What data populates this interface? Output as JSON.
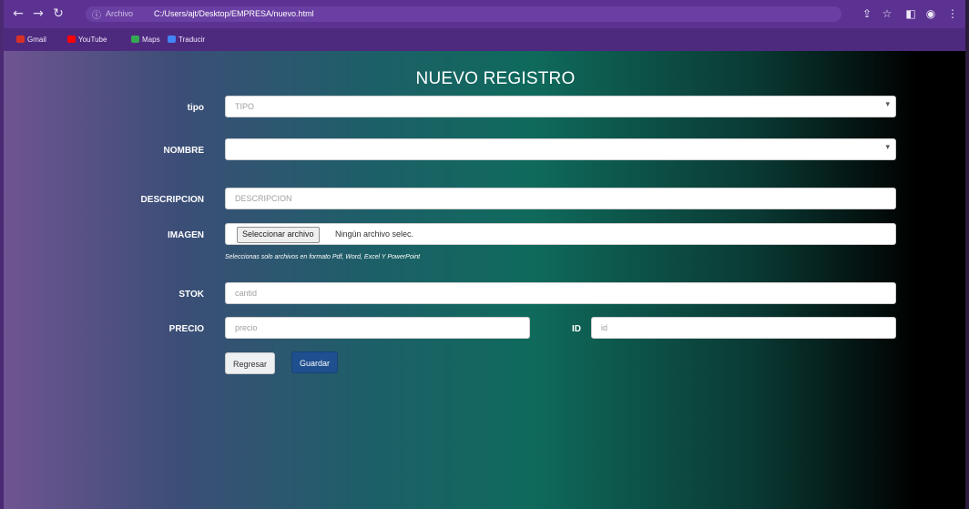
{
  "browser": {
    "address_label": "Archivo",
    "url": "C:/Users/ajt/Desktop/EMPRESA/nuevo.html",
    "bookmarks": [
      {
        "label": "Gmail",
        "color": "#d93025"
      },
      {
        "label": "YouTube",
        "color": "#ff0000"
      },
      {
        "label": "Maps",
        "color": "#34a853"
      },
      {
        "label": "Traducir",
        "color": "#4285f4"
      }
    ]
  },
  "form": {
    "title": "NUEVO REGISTRO",
    "tipo": {
      "label": "tipo",
      "value": "TIPO"
    },
    "nombre": {
      "label": "NOMBRE",
      "value": ""
    },
    "descripcion": {
      "label": "DESCRIPCION",
      "placeholder": "DESCRIPCION"
    },
    "imagen": {
      "label": "IMAGEN",
      "button": "Seleccionar archivo",
      "status": "Ningún archivo selec.",
      "help": "Seleccionas solo archivos en formato Pdf, Word, Excel Y PowerPoint"
    },
    "stok": {
      "label": "STOK",
      "placeholder": "cantid"
    },
    "precio": {
      "label": "PRECIO",
      "placeholder": "precio"
    },
    "id": {
      "label": "ID",
      "placeholder": "id"
    },
    "back_button": "Regresar",
    "save_button": "Guardar"
  },
  "colors": {
    "browser_bar": "#5b3291",
    "save_button": "#1f4f8f"
  }
}
